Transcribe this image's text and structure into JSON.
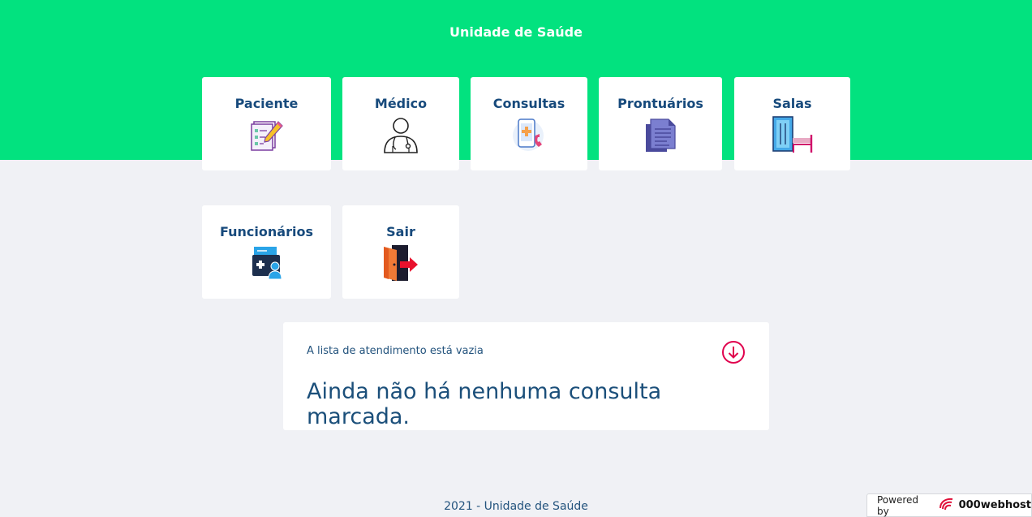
{
  "header": {
    "title": "Unidade de Saúde",
    "color": "#02e27f"
  },
  "menu": {
    "paciente": "Paciente",
    "medico": "Médico",
    "consultas": "Consultas",
    "prontuarios": "Prontuários",
    "salas": "Salas",
    "funcionarios": "Funcionários",
    "sair": "Sair"
  },
  "notice": {
    "small": "A lista de atendimento está vazia",
    "big": "Ainda não há nenhuma consulta marcada.",
    "icon": "arrow-down-circle-icon",
    "accent": "#e0004d"
  },
  "footer": {
    "text": "2021 - Unidade de Saúde"
  },
  "powered": {
    "label": "Powered by",
    "brand": "000webhost"
  }
}
